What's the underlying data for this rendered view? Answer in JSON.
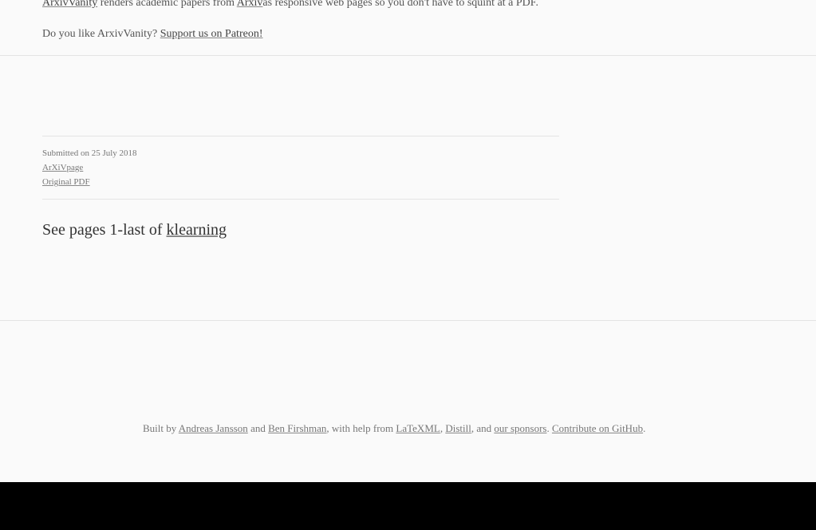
{
  "banner": {
    "arxiv_vanity": "ArxivVanity",
    "renders_text": " renders academic papers from ",
    "arxiv": "Arxiv",
    "rest": "as responsive web pages so you don't have to squint at a PDF.",
    "question": "Do you like ArxivVanity? ",
    "patreon": "Support us on Patreon!"
  },
  "meta": {
    "submitted": "Submitted on 25 July 2018",
    "arxiv_page": "ArXiVpage",
    "original_pdf": "Original PDF"
  },
  "page": {
    "title_prefix": "See pages 1-last of ",
    "title_link": "klearning"
  },
  "footer": {
    "built_by": "Built by ",
    "andreas": "Andreas Jansson",
    "and1": " and ",
    "ben": "Ben Firshman",
    "with_help": ", with help from ",
    "latexml": "LaTeXML",
    "comma": ", ",
    "distill": "Distill",
    "and2": ", and ",
    "sponsors": "our sponsors",
    "period": ". ",
    "github": "Contribute on GitHub",
    "end": "."
  }
}
